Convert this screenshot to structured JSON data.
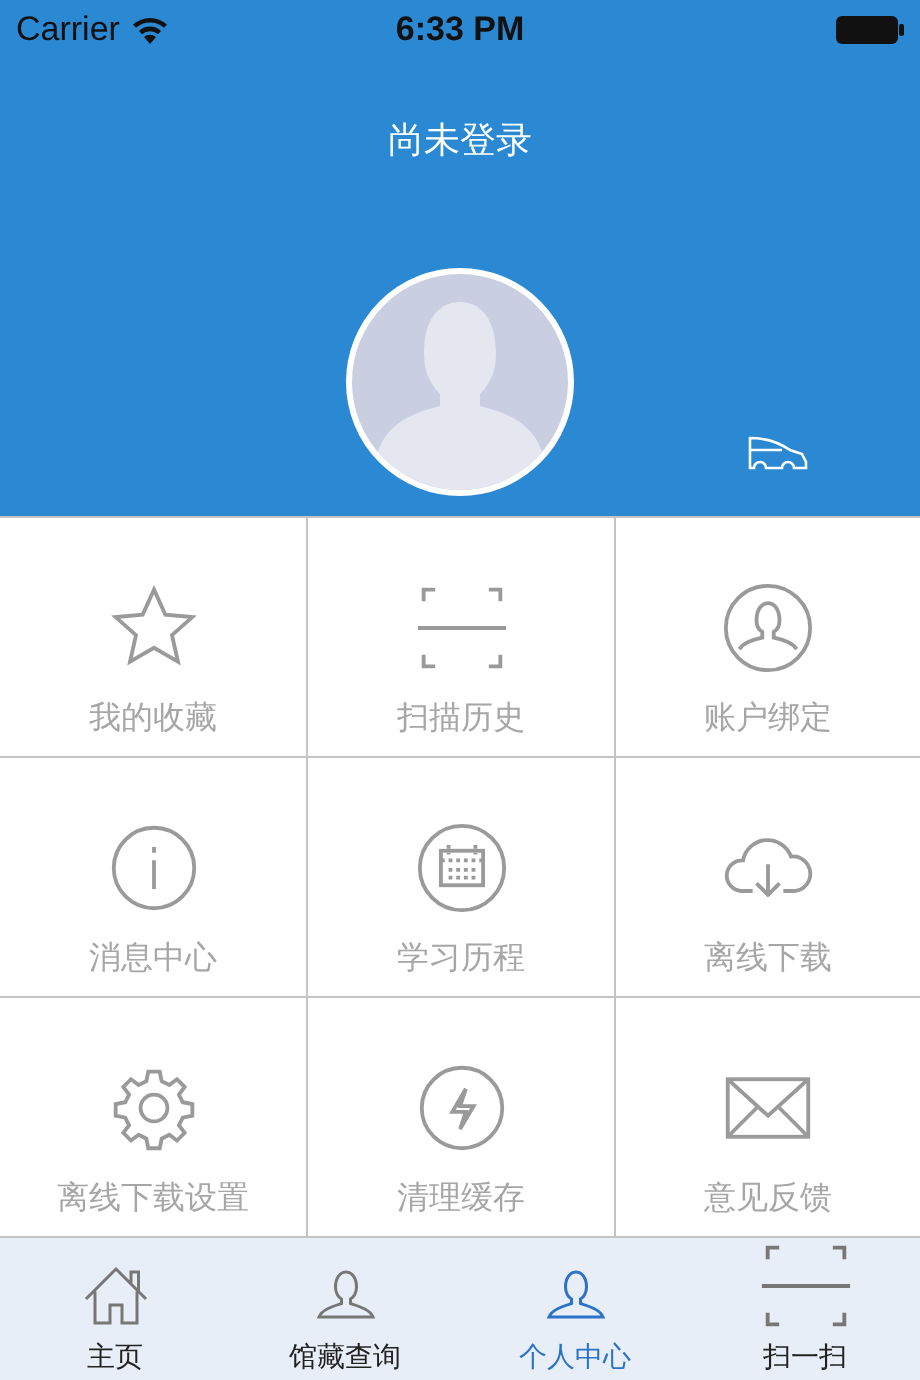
{
  "status_bar": {
    "carrier": "Carrier",
    "time": "6:33 PM"
  },
  "header": {
    "title": "尚未登录"
  },
  "grid": [
    {
      "label": "我的收藏"
    },
    {
      "label": "扫描历史"
    },
    {
      "label": "账户绑定"
    },
    {
      "label": "消息中心"
    },
    {
      "label": "学习历程"
    },
    {
      "label": "离线下载"
    },
    {
      "label": "离线下载设置"
    },
    {
      "label": "清理缓存"
    },
    {
      "label": "意见反馈"
    }
  ],
  "tabs": [
    {
      "label": "主页",
      "selected": false
    },
    {
      "label": "馆藏查询",
      "selected": false
    },
    {
      "label": "个人中心",
      "selected": true
    },
    {
      "label": "扫一扫",
      "selected": false
    }
  ]
}
